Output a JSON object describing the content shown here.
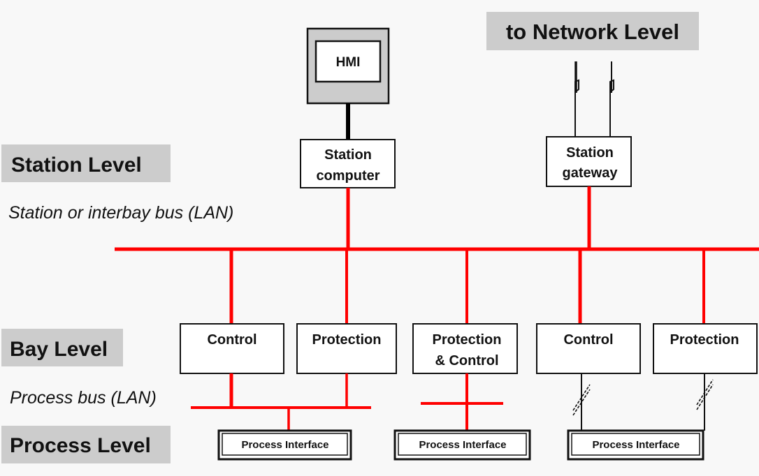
{
  "levels": {
    "station": "Station Level",
    "bay": "Bay Level",
    "process": "Process Level",
    "network": "to Network Level"
  },
  "buses": {
    "station_bus": "Station or interbay bus (LAN)",
    "process_bus": "Process bus (LAN)"
  },
  "station_devices": {
    "hmi": "HMI",
    "computer": [
      "Station",
      "computer"
    ],
    "gateway": [
      "Station",
      "gateway"
    ]
  },
  "bay_devices": [
    {
      "lines": [
        "Control"
      ]
    },
    {
      "lines": [
        "Protection"
      ]
    },
    {
      "lines": [
        "Protection",
        "& Control"
      ]
    },
    {
      "lines": [
        "Control"
      ]
    },
    {
      "lines": [
        "Protection"
      ]
    }
  ],
  "process_interfaces": [
    "Process Interface",
    "Process Interface",
    "Process Interface"
  ],
  "colors": {
    "lan": "#ff0000",
    "label_bg": "#cccccc",
    "line": "#111111"
  }
}
